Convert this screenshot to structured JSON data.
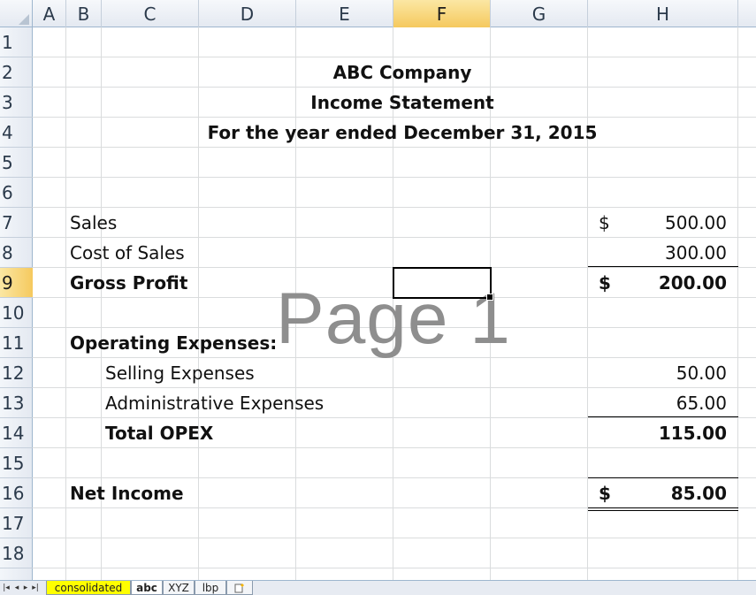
{
  "column_headers": [
    "A",
    "B",
    "C",
    "D",
    "E",
    "F",
    "G",
    "H"
  ],
  "selected_column": "F",
  "row_headers": [
    "1",
    "2",
    "3",
    "4",
    "5",
    "6",
    "7",
    "8",
    "9",
    "10",
    "11",
    "12",
    "13",
    "14",
    "15",
    "16",
    "17",
    "18"
  ],
  "selected_row": "9",
  "statement": {
    "company": "ABC Company",
    "title": "Income Statement",
    "period": "For the year ended December 31, 2015"
  },
  "rows": {
    "sales": {
      "label": "Sales",
      "currency": "$",
      "amount": "500.00"
    },
    "cost_of_sales": {
      "label": "Cost of Sales",
      "amount": "300.00"
    },
    "gross_profit": {
      "label": "Gross Profit",
      "currency": "$",
      "amount": "200.00"
    },
    "opex_header": {
      "label": "Operating Expenses:"
    },
    "selling": {
      "label": "Selling  Expenses",
      "amount": "50.00"
    },
    "admin": {
      "label": "Administrative Expenses",
      "amount": "65.00"
    },
    "total_opex": {
      "label": "Total OPEX",
      "amount": "115.00"
    },
    "net_income": {
      "label": "Net Income",
      "currency": "$",
      "amount": "85.00"
    }
  },
  "watermark": "Page 1",
  "sheet_tabs": [
    {
      "label": "consolidated",
      "color": "#ffff00"
    },
    {
      "label": "abc",
      "active": true
    },
    {
      "label": "XYZ"
    },
    {
      "label": "lbp"
    }
  ],
  "colors": {
    "selection_header": "#f5c95e",
    "header_bg": "#e4e9f1",
    "gridline": "#dadcdd"
  }
}
